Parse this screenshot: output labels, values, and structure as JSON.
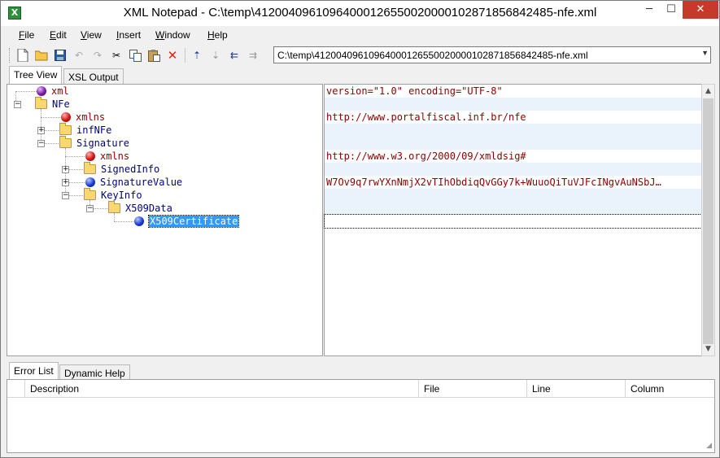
{
  "window": {
    "title": "XML Notepad - C:\\temp\\41200409610964000126550020000102871856842485-nfe.xml",
    "icon_name": "xml-notepad-icon",
    "controls": {
      "minimize": "─",
      "maximize": "☐",
      "close": "✕"
    }
  },
  "menu": {
    "items": [
      {
        "label": "File",
        "mnemonic": "F"
      },
      {
        "label": "Edit",
        "mnemonic": "E"
      },
      {
        "label": "View",
        "mnemonic": "V"
      },
      {
        "label": "Insert",
        "mnemonic": "I"
      },
      {
        "label": "Window",
        "mnemonic": "W"
      },
      {
        "label": "Help",
        "mnemonic": "H"
      }
    ]
  },
  "toolbar": {
    "location": "C:\\temp\\41200409610964000126550020000102871856842485-nfe.xml"
  },
  "tabs": {
    "tree_view": "Tree View",
    "xsl_output": "XSL Output"
  },
  "tree": {
    "nodes": [
      {
        "label": "xml",
        "type": "pi"
      },
      {
        "label": "NFe",
        "type": "element"
      },
      {
        "label": "xmlns",
        "type": "attribute"
      },
      {
        "label": "infNFe",
        "type": "element"
      },
      {
        "label": "Signature",
        "type": "element"
      },
      {
        "label": "xmlns",
        "type": "attribute"
      },
      {
        "label": "SignedInfo",
        "type": "element"
      },
      {
        "label": "SignatureValue",
        "type": "text"
      },
      {
        "label": "KeyInfo",
        "type": "element"
      },
      {
        "label": "X509Data",
        "type": "element"
      },
      {
        "label": "X509Certificate",
        "type": "text"
      }
    ]
  },
  "values": [
    "version=\"1.0\" encoding=\"UTF-8\"",
    "",
    "http://www.portalfiscal.inf.br/nfe",
    "",
    "",
    "http://www.w3.org/2000/09/xmldsig#",
    "",
    "W7Ov9q7rwYXnNmjX2vTIhObdiqQvGGy7k+WuuoQiTuVJFcINgvAuNSbJ…",
    "",
    "",
    ""
  ],
  "bottom_tabs": {
    "error_list": "Error List",
    "dynamic_help": "Dynamic Help"
  },
  "error_list": {
    "columns": [
      "Description",
      "File",
      "Line",
      "Column"
    ]
  }
}
